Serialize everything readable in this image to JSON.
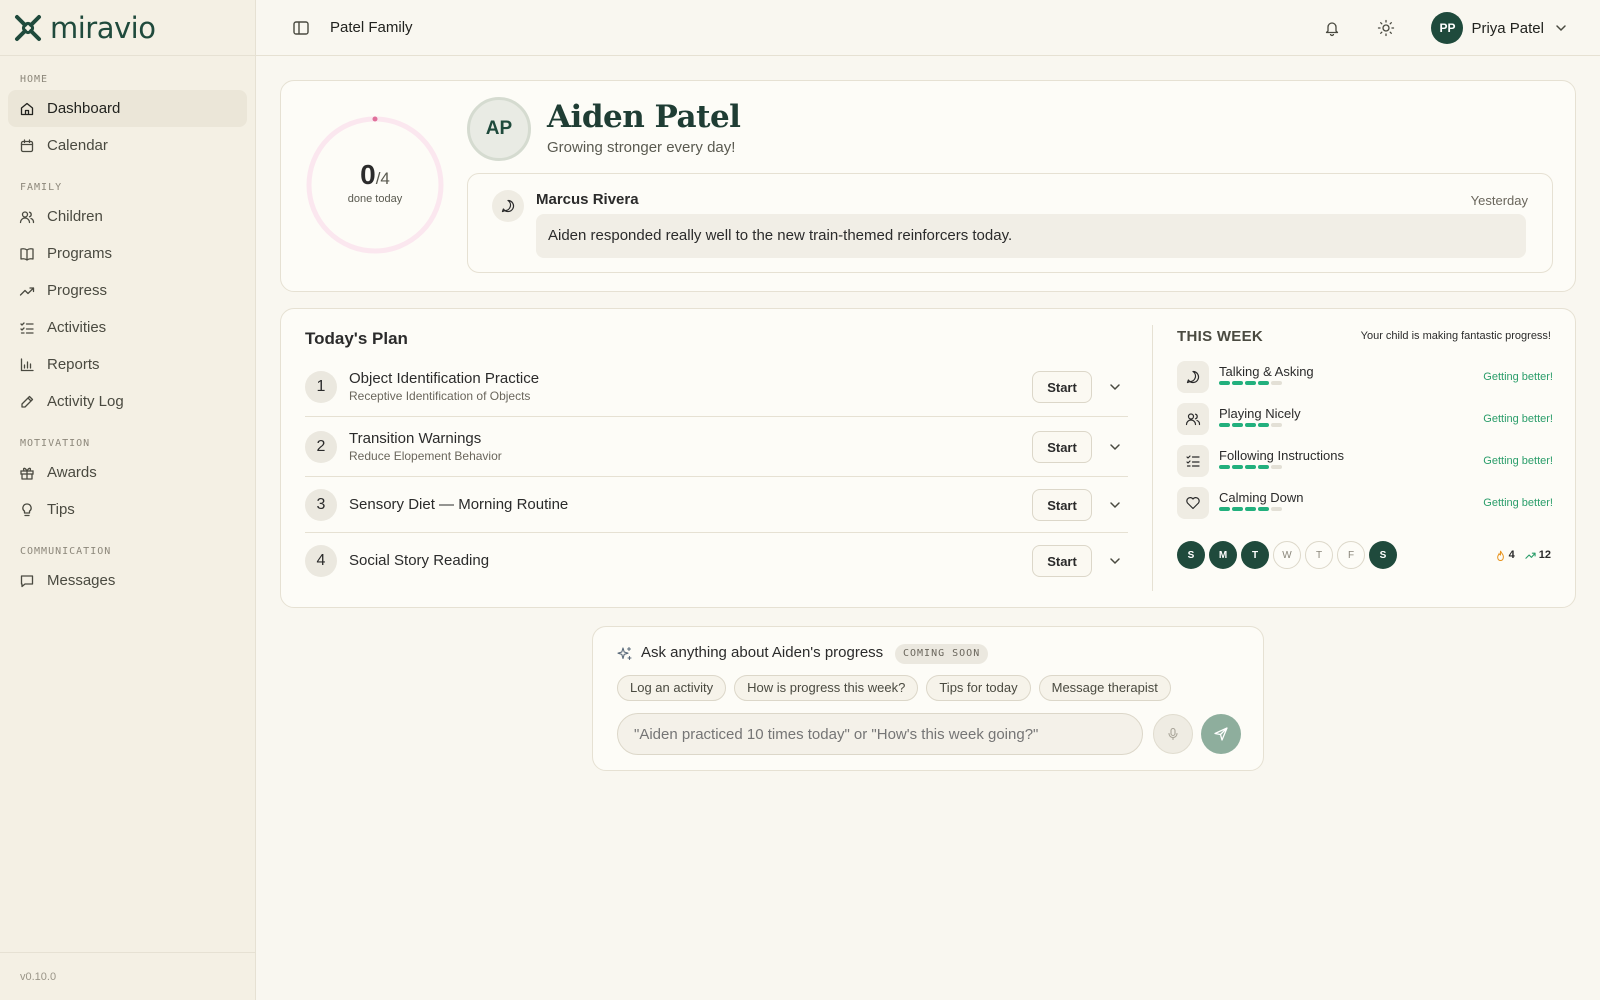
{
  "brand": {
    "name": "miravio"
  },
  "sidebar": {
    "sections": [
      {
        "label": "HOME",
        "items": [
          "Dashboard",
          "Calendar"
        ]
      },
      {
        "label": "FAMILY",
        "items": [
          "Children",
          "Programs",
          "Progress",
          "Activities",
          "Reports",
          "Activity Log"
        ]
      },
      {
        "label": "MOTIVATION",
        "items": [
          "Awards",
          "Tips"
        ]
      },
      {
        "label": "COMMUNICATION",
        "items": [
          "Messages"
        ]
      }
    ],
    "active": "Dashboard",
    "version": "v0.10.0"
  },
  "header": {
    "family_name": "Patel Family",
    "user": {
      "initials": "PP",
      "name": "Priya Patel"
    }
  },
  "summary": {
    "done": "0",
    "total": "/4",
    "done_label": "done today",
    "progress_fraction": 0,
    "child_initials": "AP",
    "child_name": "Aiden Patel",
    "child_tagline": "Growing stronger every day!",
    "note": {
      "from": "Marcus Rivera",
      "time": "Yesterday",
      "message": "Aiden responded really well to the new train-themed reinforcers today."
    }
  },
  "plan": {
    "title": "Today's Plan",
    "start_label": "Start",
    "items": [
      {
        "num": "1",
        "title": "Object Identification Practice",
        "subtitle": "Receptive Identification of Objects"
      },
      {
        "num": "2",
        "title": "Transition Warnings",
        "subtitle": "Reduce Elopement Behavior"
      },
      {
        "num": "3",
        "title": "Sensory Diet — Morning Routine",
        "subtitle": ""
      },
      {
        "num": "4",
        "title": "Social Story Reading",
        "subtitle": ""
      }
    ]
  },
  "week": {
    "title": "THIS WEEK",
    "message": "Your child is making fantastic progress!",
    "skills": [
      {
        "name": "Talking & Asking",
        "status": "Getting better!",
        "level": 4,
        "max": 5,
        "icon": "speech-bubble-icon"
      },
      {
        "name": "Playing Nicely",
        "status": "Getting better!",
        "level": 4,
        "max": 5,
        "icon": "people-icon"
      },
      {
        "name": "Following Instructions",
        "status": "Getting better!",
        "level": 4,
        "max": 5,
        "icon": "checklist-icon"
      },
      {
        "name": "Calming Down",
        "status": "Getting better!",
        "level": 4,
        "max": 5,
        "icon": "heart-icon"
      }
    ],
    "days": [
      {
        "letter": "S",
        "done": true
      },
      {
        "letter": "M",
        "done": true
      },
      {
        "letter": "T",
        "done": true
      },
      {
        "letter": "W",
        "done": false
      },
      {
        "letter": "T",
        "done": false
      },
      {
        "letter": "F",
        "done": false
      },
      {
        "letter": "S",
        "done": true
      }
    ],
    "streak": "4",
    "trend": "12",
    "colors": {
      "good": "#2a9d6a",
      "accent": "#1f4a3c"
    }
  },
  "ask": {
    "title": "Ask anything about Aiden's progress",
    "badge": "COMING SOON",
    "chips": [
      "Log an activity",
      "How is progress this week?",
      "Tips for today",
      "Message therapist"
    ],
    "placeholder": "\"Aiden practiced 10 times today\" or \"How's this week going?\""
  }
}
